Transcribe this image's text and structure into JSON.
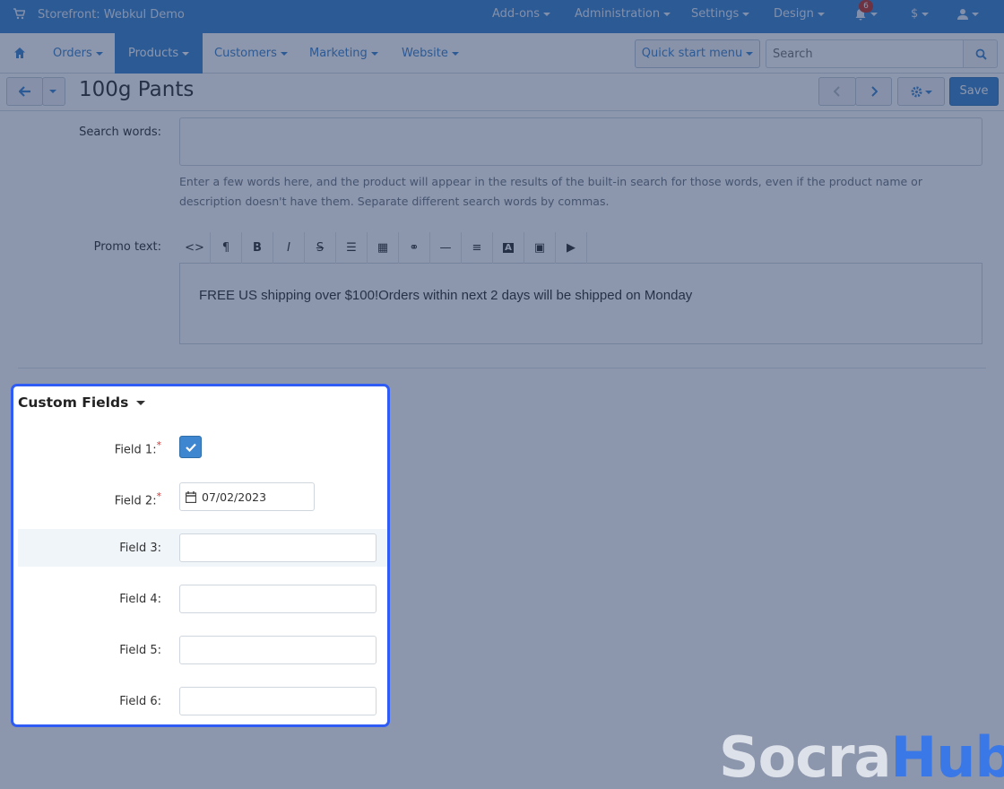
{
  "topbar": {
    "storefront": "Storefront: Webkul Demo",
    "menus": [
      "Add-ons",
      "Administration",
      "Settings",
      "Design"
    ],
    "notification_count": "6",
    "currency": "$"
  },
  "navbar": {
    "items": [
      "Orders",
      "Products",
      "Customers",
      "Marketing",
      "Website"
    ],
    "active": "Products",
    "quick_start": "Quick start menu",
    "search_placeholder": "Search"
  },
  "titlebar": {
    "title": "100g Pants",
    "save": "Save"
  },
  "form": {
    "search_words_label": "Search words:",
    "search_words_help": "Enter a few words here, and the product will appear in the results of the built-in search for those words, even if the product name or description doesn't have them. Separate different search words by commas.",
    "promo_label": "Promo text:",
    "promo_text": "FREE US shipping over $100!Orders within next 2 days will be shipped on Monday"
  },
  "custom_fields": {
    "header": "Custom Fields",
    "fields": [
      {
        "label": "Field 1:",
        "required": true,
        "type": "checkbox",
        "checked": true
      },
      {
        "label": "Field 2:",
        "required": true,
        "type": "date",
        "value": "07/02/2023"
      },
      {
        "label": "Field 3:",
        "required": false,
        "type": "text",
        "value": ""
      },
      {
        "label": "Field 4:",
        "required": false,
        "type": "text",
        "value": ""
      },
      {
        "label": "Field 5:",
        "required": false,
        "type": "text",
        "value": ""
      },
      {
        "label": "Field 6:",
        "required": false,
        "type": "text",
        "value": ""
      }
    ]
  },
  "watermark": {
    "part1": "Socra",
    "part2": "Hub"
  },
  "colors": {
    "accent": "#3f86d0",
    "highlight_border": "#2f5cf5",
    "required": "#e0302f"
  }
}
